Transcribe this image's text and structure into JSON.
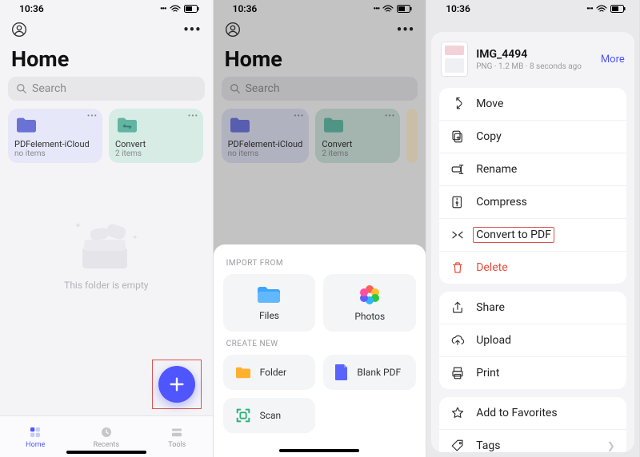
{
  "statusbar": {
    "time": "10:36"
  },
  "header": {
    "title": "Home"
  },
  "search": {
    "placeholder": "Search"
  },
  "folders": [
    {
      "name": "PDFelement-iCloud",
      "sub": "no items"
    },
    {
      "name": "Convert",
      "sub": "2 items"
    }
  ],
  "empty_text": "This folder is empty",
  "tabs": {
    "home": "Home",
    "recents": "Recents",
    "tools": "Tools"
  },
  "sheet2": {
    "import_label": "IMPORT FROM",
    "files": "Files",
    "photos": "Photos",
    "create_label": "CREATE NEW",
    "folder": "Folder",
    "blank_pdf": "Blank PDF",
    "scan": "Scan"
  },
  "file": {
    "name": "IMG_4494",
    "type": "PNG",
    "size": "1.2 MB",
    "age": "8 seconds ago",
    "more": "More"
  },
  "actions": {
    "move": "Move",
    "copy": "Copy",
    "rename": "Rename",
    "compress": "Compress",
    "convert": "Convert to PDF",
    "delete": "Delete",
    "share": "Share",
    "upload": "Upload",
    "print": "Print",
    "favorite": "Add to Favorites",
    "tags": "Tags"
  }
}
